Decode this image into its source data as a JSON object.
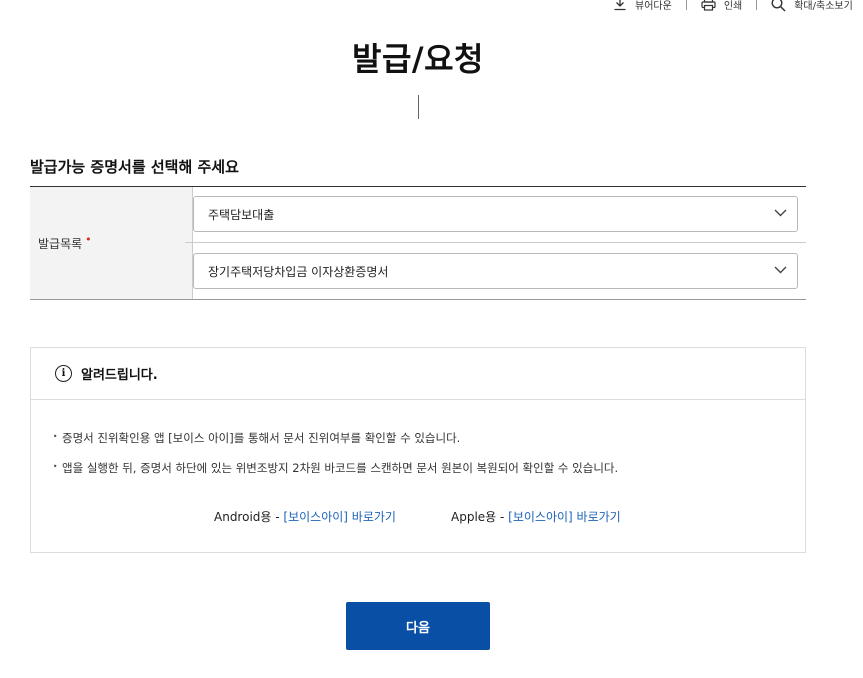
{
  "utility": {
    "viewer_download": "뷰어다운",
    "print": "인쇄",
    "zoom": "확대/축소보기"
  },
  "page_title": "발급/요청",
  "section_title": "발급가능 증명서를 선택해 주세요",
  "form": {
    "label": "발급목록",
    "required_mark": "•",
    "select1_value": "주택담보대출",
    "select2_value": "장기주택저당차입금 이자상환증명서"
  },
  "notice": {
    "title": "알려드립니다.",
    "items": [
      "증명서 진위확인용 앱 [보이스 아이]를 통해서 문서 진위여부를 확인할 수 있습니다.",
      "앱을 실행한 뒤, 증명서 하단에 있는 위변조방지 2차원 바코드를 스캔하면 문서 원본이 복원되어 확인할 수 있습니다."
    ],
    "android_prefix": "Android용 - ",
    "android_link": "[보이스아이] 바로가기",
    "apple_prefix": "Apple용 - ",
    "apple_link": "[보이스아이] 바로가기"
  },
  "next_button": "다음"
}
